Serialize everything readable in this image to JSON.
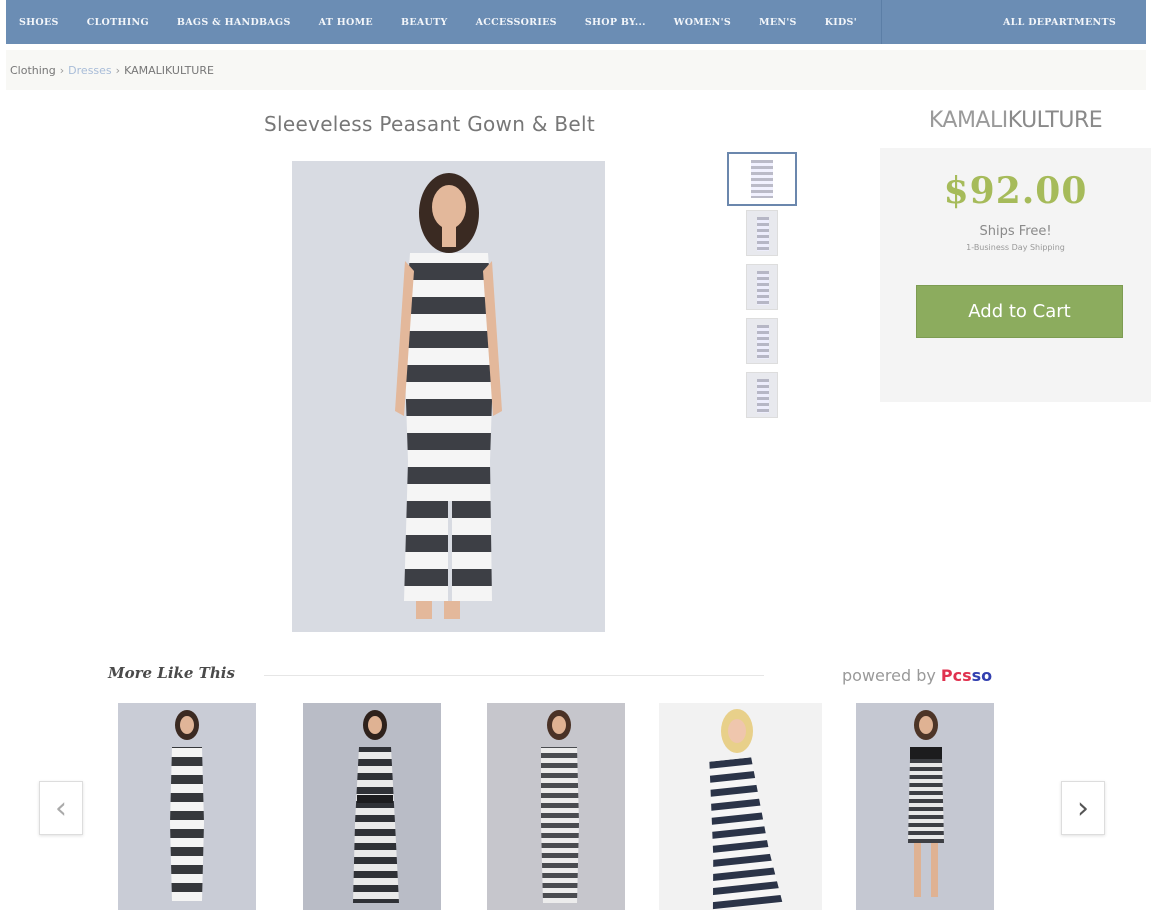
{
  "nav": {
    "items": [
      "SHOES",
      "CLOTHING",
      "BAGS & HANDBAGS",
      "AT HOME",
      "BEAUTY",
      "ACCESSORIES",
      "SHOP BY...",
      "WOMEN'S",
      "MEN'S",
      "KIDS'"
    ],
    "all_departments": "ALL DEPARTMENTS"
  },
  "breadcrumb": {
    "items": [
      "Clothing",
      "Dresses",
      "KAMALIKULTURE"
    ],
    "separator": "›"
  },
  "product": {
    "title": "Sleeveless Peasant Gown & Belt"
  },
  "buybox": {
    "brand_light": "KAMALI",
    "brand_bold": "KULTURE",
    "price": "$92.00",
    "ships": "Ships Free!",
    "ships_sub": "1-Business Day Shipping",
    "add_to_cart": "Add to Cart"
  },
  "recommendations": {
    "title": "More Like This",
    "powered_by": "powered by",
    "powered_brand_a": "Pcs",
    "powered_brand_b": "so",
    "prev": "‹",
    "next": "›"
  },
  "colors": {
    "nav_bg": "#6b8db4",
    "price": "#a6bb5a",
    "cart_button": "#8cac5e"
  }
}
